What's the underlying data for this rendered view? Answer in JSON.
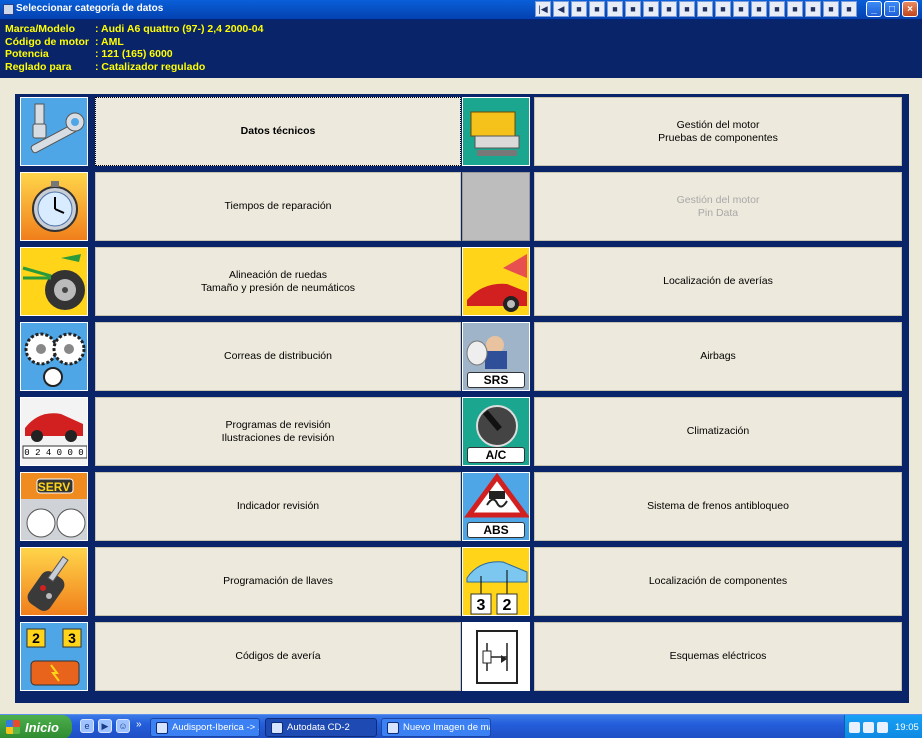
{
  "window": {
    "title": "Seleccionar categoría de datos"
  },
  "toolbar": {
    "icons": [
      "first-icon",
      "back-icon",
      "tech-data-icon",
      "timer-icon",
      "wheel-icon",
      "belt-icon",
      "service-icon",
      "indicator-icon",
      "key-icon",
      "fault-code-icon",
      "engine-icon",
      "pin-data-icon",
      "diagnosis-icon",
      "airbag-icon",
      "ac-icon",
      "abs-icon",
      "component-icon",
      "wiring-icon"
    ]
  },
  "vehicle": [
    {
      "label": "Marca/Modelo",
      "value": ": Audi   A6 quattro (97-) 2,4  2000-04"
    },
    {
      "label": "Código de motor",
      "value": ": AML"
    },
    {
      "label": "Potencia",
      "value": ": 121 (165) 6000"
    },
    {
      "label": "Reglado para",
      "value": ": Catalizador regulado"
    }
  ],
  "categories_left": [
    {
      "line1": "Datos técnicos",
      "line2": "",
      "icon": "wrench-icon"
    },
    {
      "line1": "Tiempos de reparación",
      "line2": "",
      "icon": "stopwatch-icon"
    },
    {
      "line1": "Alineación de ruedas",
      "line2": "Tamaño y presión de neumáticos",
      "icon": "wheel-alignment-icon"
    },
    {
      "line1": "Correas de distribución",
      "line2": "",
      "icon": "timing-belt-icon"
    },
    {
      "line1": "Programas de revisión",
      "line2": "Ilustraciones de revisión",
      "icon": "service-schedule-icon",
      "counter": "024000"
    },
    {
      "line1": "Indicador revisión",
      "line2": "",
      "icon": "service-indicator-icon",
      "badge": "SERV"
    },
    {
      "line1": "Programación de llaves",
      "line2": "",
      "icon": "key-programming-icon"
    },
    {
      "line1": "Códigos de avería",
      "line2": "",
      "icon": "fault-codes-icon",
      "digits": [
        "2",
        "3"
      ]
    }
  ],
  "categories_right": [
    {
      "line1": "Gestión del motor",
      "line2": "Pruebas de componentes",
      "icon": "ecu-icon",
      "disabled": false
    },
    {
      "line1": "Gestión del motor",
      "line2": "Pin Data",
      "icon": "blank-icon",
      "disabled": true
    },
    {
      "line1": "Localización de averías",
      "line2": "",
      "icon": "diagnosis-icon",
      "disabled": false
    },
    {
      "line1": "Airbags",
      "line2": "",
      "icon": "airbag-icon",
      "badge": "SRS",
      "disabled": false
    },
    {
      "line1": "Climatización",
      "line2": "",
      "icon": "ac-icon",
      "badge": "A/C",
      "disabled": false
    },
    {
      "line1": "Sistema de frenos antibloqueo",
      "line2": "",
      "icon": "abs-icon",
      "badge": "ABS",
      "disabled": false
    },
    {
      "line1": "Localización de componentes",
      "line2": "",
      "icon": "component-location-icon",
      "digits": [
        "3",
        "2"
      ],
      "disabled": false
    },
    {
      "line1": "Esquemas eléctricos",
      "line2": "",
      "icon": "wiring-diagram-icon",
      "disabled": false
    }
  ],
  "taskbar": {
    "start_label": "Inicio",
    "tasks": [
      {
        "label": "Audisport-Iberica -> ..."
      },
      {
        "label": "Autodata CD-2"
      },
      {
        "label": "Nuevo Imagen de ma..."
      }
    ],
    "clock": "19:05"
  },
  "colors": {
    "frame": "#0a246a",
    "info_text": "#ffff00",
    "cell_bg": "#ede9dc",
    "disabled_text": "#a8a8a8"
  }
}
